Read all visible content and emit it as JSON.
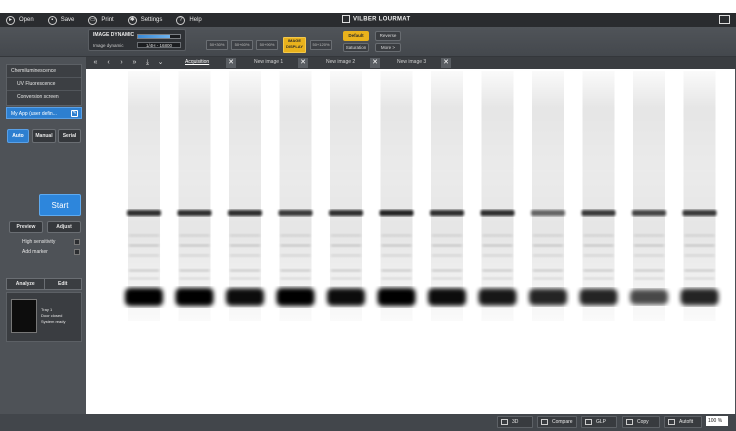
{
  "topbar": {
    "items": [
      {
        "label": "Open",
        "icon": "open-icon"
      },
      {
        "label": "Save",
        "icon": "save-icon"
      },
      {
        "label": "Print",
        "icon": "print-icon"
      },
      {
        "label": "Settings",
        "icon": "gear-icon"
      },
      {
        "label": "Help",
        "icon": "help-icon"
      }
    ],
    "brand": "VILBER LOURMAT"
  },
  "image_dynamic": {
    "title": "IMAGE DYNAMIC",
    "label": "Image dynamic",
    "range": "1/4H - 16800",
    "level": 0.75
  },
  "exposure_presets": [
    "50+30%",
    "50+60%",
    "50+90%",
    "IMAGE DISPLAY",
    "50+120%"
  ],
  "display_buttons": {
    "default": "Default",
    "saturation": "Saturation",
    "reverse": "Reverse",
    "more": "More >"
  },
  "sidebar": {
    "menu": [
      "Chemiluminescence",
      "UV Fluorescence",
      "Conversion screen"
    ],
    "my_app": "My App (user defin...",
    "modes": [
      "Auto",
      "Manual",
      "Serial"
    ],
    "start": "Start",
    "preview": "Preview",
    "adjust": "Adjust",
    "options": [
      "High sensitivity",
      "Add marker"
    ],
    "bottom_tabs": [
      "Analyze",
      "Edit"
    ],
    "tray_status": [
      "Tray 1",
      "Door closed",
      "System ready"
    ]
  },
  "image_tabs": {
    "nav": [
      "«",
      "‹",
      "›",
      "»",
      "⤓",
      "⌄"
    ],
    "tabs": [
      "Acquisition",
      "New image 1",
      "New image 2",
      "New image 3"
    ]
  },
  "gel": {
    "lanes": [
      {
        "upper_band": 0.85,
        "lower_band": 1.0
      },
      {
        "upper_band": 0.85,
        "lower_band": 1.0
      },
      {
        "upper_band": 0.85,
        "lower_band": 0.95
      },
      {
        "upper_band": 0.8,
        "lower_band": 1.0
      },
      {
        "upper_band": 0.85,
        "lower_band": 0.95
      },
      {
        "upper_band": 0.9,
        "lower_band": 1.0
      },
      {
        "upper_band": 0.85,
        "lower_band": 0.95
      },
      {
        "upper_band": 0.85,
        "lower_band": 0.9
      },
      {
        "upper_band": 0.6,
        "lower_band": 0.85
      },
      {
        "upper_band": 0.8,
        "lower_band": 0.85
      },
      {
        "upper_band": 0.75,
        "lower_band": 0.7
      },
      {
        "upper_band": 0.8,
        "lower_band": 0.85
      }
    ]
  },
  "bottombar": {
    "buttons": [
      {
        "label": "3D",
        "icon": "3d-icon"
      },
      {
        "label": "Compare",
        "icon": "compare-icon"
      },
      {
        "label": "GLP",
        "icon": "glp-icon"
      },
      {
        "label": "Copy",
        "icon": "copy-icon"
      },
      {
        "label": "Autofit",
        "icon": "autofit-icon"
      }
    ],
    "zoom": "100 %"
  },
  "colors": {
    "accent_blue": "#2d7fd0",
    "accent_yellow": "#e9b21c",
    "panel": "#4b4f55"
  }
}
